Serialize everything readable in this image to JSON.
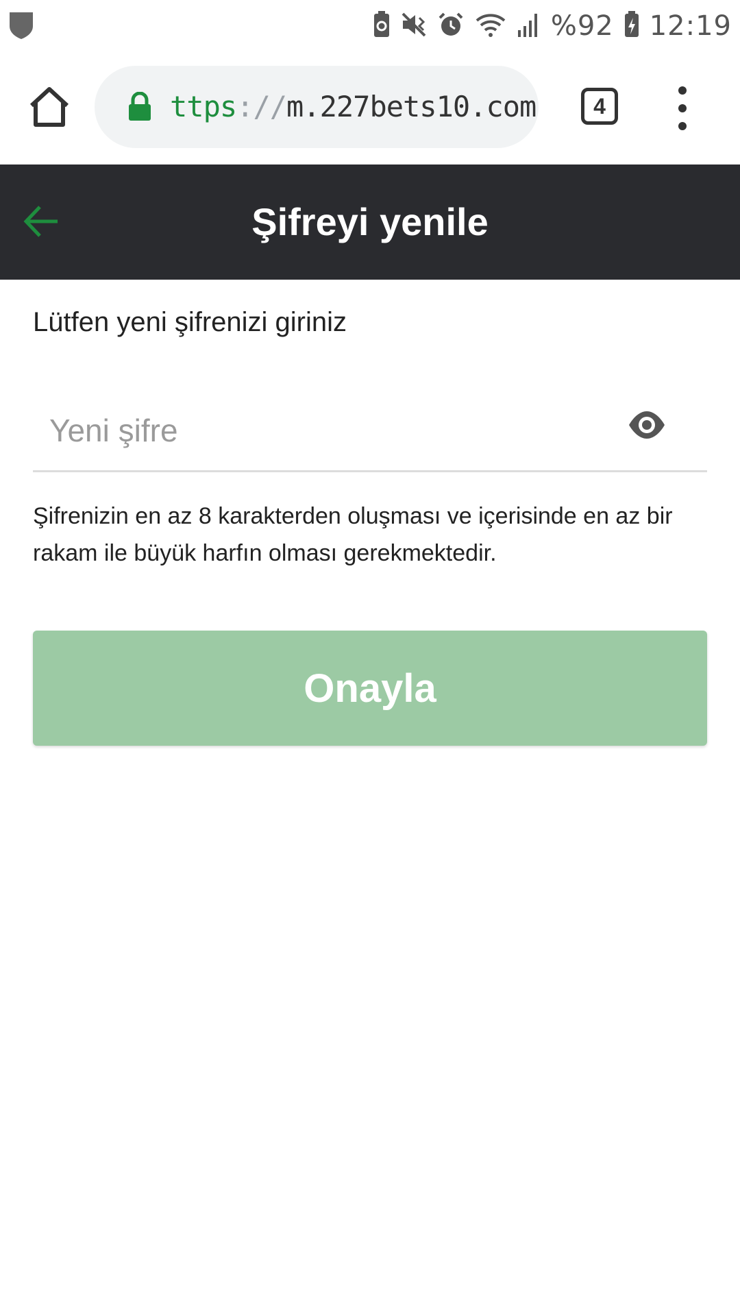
{
  "status_bar": {
    "battery": "%92",
    "time": "12:19"
  },
  "browser": {
    "url_scheme": "ttps",
    "url_separator": "://",
    "url_host": "m.227bets10.com",
    "tab_count": "4"
  },
  "header": {
    "title": "Şifreyi yenile"
  },
  "form": {
    "prompt": "Lütfen yeni şifrenizi giriniz",
    "password_placeholder": "Yeni şifre",
    "password_value": "",
    "hint": "Şifrenizin en az 8 karakterden oluşması ve içerisinde en az bir rakam ile büyük harfın olması gerekmektedir.",
    "confirm_label": "Onayla"
  },
  "colors": {
    "header_bg": "#2a2b2f",
    "accent_green": "#1e8e3e",
    "button_bg": "#9ccaa4"
  },
  "icons": [
    "shield-icon",
    "battery-saver-icon",
    "mute-vibrate-icon",
    "alarm-icon",
    "wifi-icon",
    "signal-icon",
    "battery-charging-icon",
    "home-icon",
    "lock-icon",
    "tabs-icon",
    "more-vert-icon",
    "back-arrow-icon",
    "eye-icon"
  ]
}
